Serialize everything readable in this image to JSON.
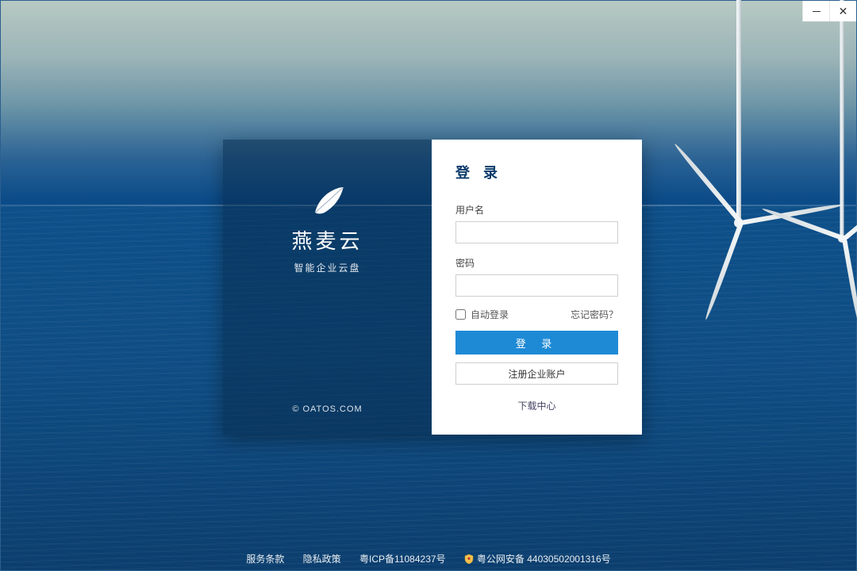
{
  "brand": {
    "name": "燕麦云",
    "subtitle": "智能企业云盘",
    "copyright": "© OATOS.COM"
  },
  "form": {
    "title": "登 录",
    "username_label": "用户名",
    "username_value": "",
    "password_label": "密码",
    "password_value": "",
    "auto_login_label": "自动登录",
    "forgot_label": "忘记密码？",
    "login_button": "登 录",
    "register_button": "注册企业账户",
    "download_label": "下载中心"
  },
  "footer": {
    "terms": "服务条款",
    "privacy": "隐私政策",
    "icp": "粤ICP备11084237号",
    "police": "粤公网安备 44030502001316号"
  },
  "window": {
    "minimize_tooltip": "最小化",
    "close_tooltip": "关闭"
  }
}
